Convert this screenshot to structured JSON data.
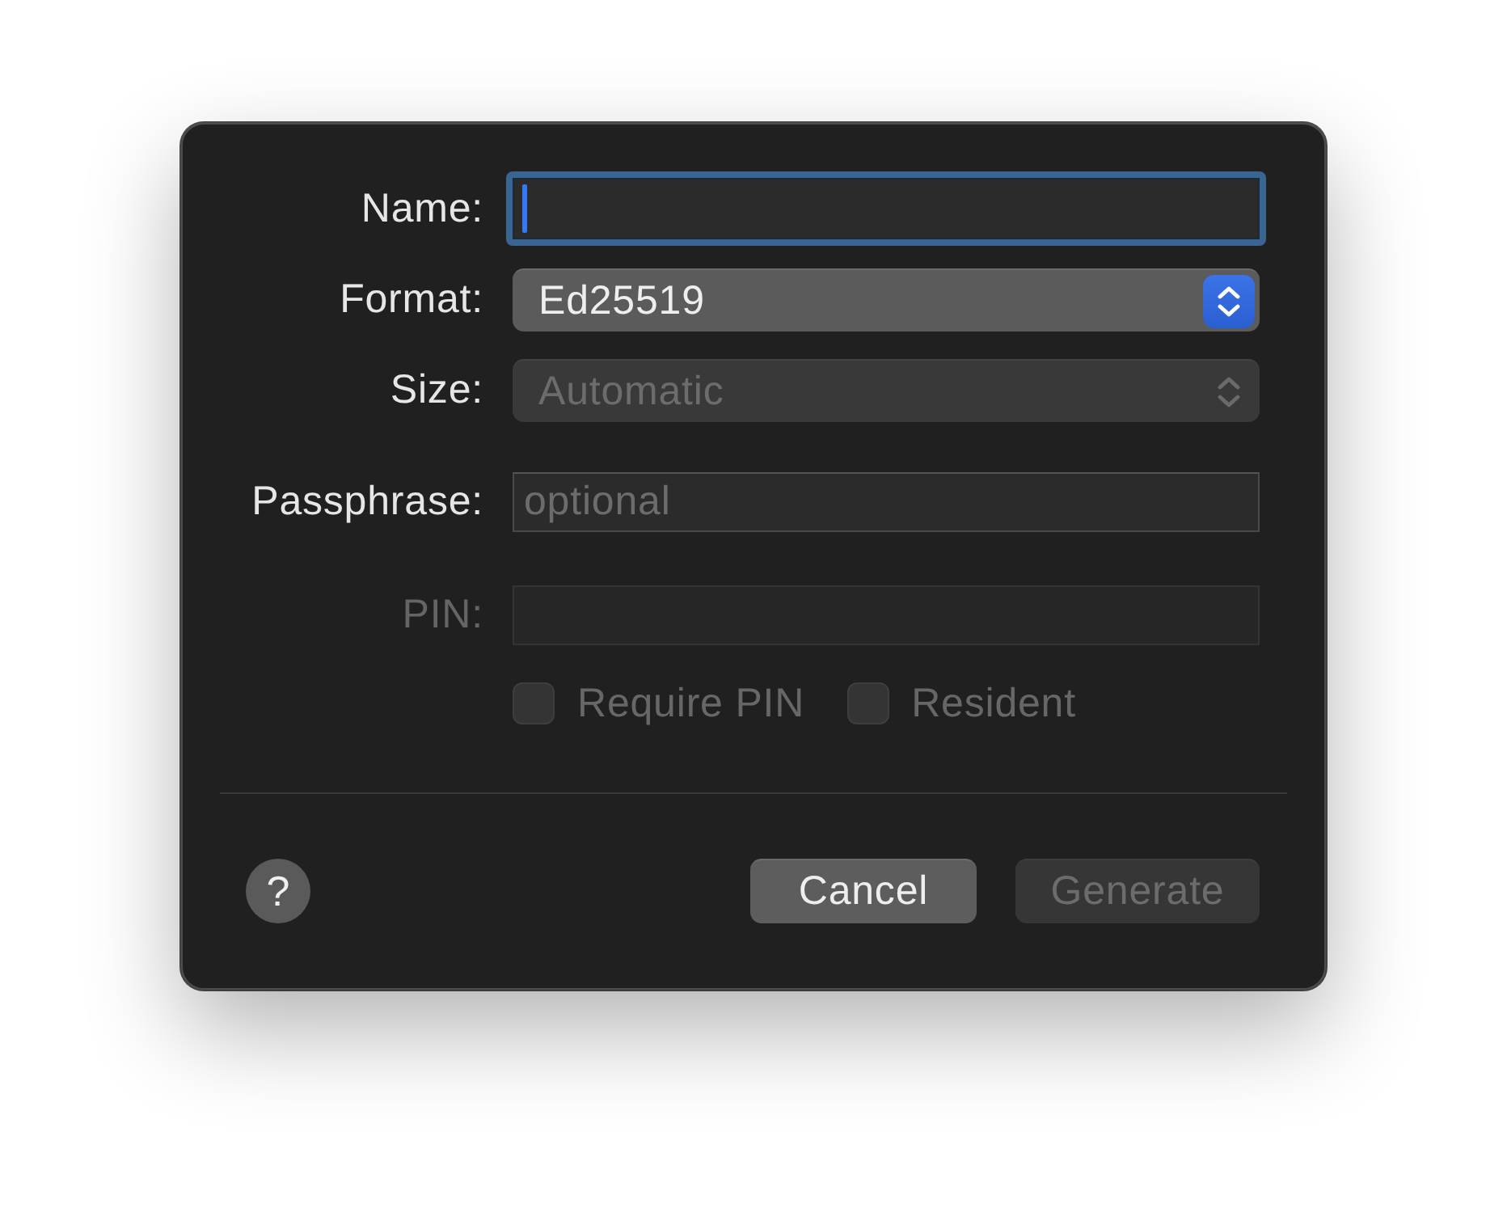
{
  "dialog": {
    "fields": [
      {
        "kind": "text",
        "label": {
          "text": "Name:",
          "disabled": false
        },
        "focused": true,
        "disabled": false
      },
      {
        "kind": "popup",
        "label": {
          "text": "Format:",
          "disabled": false
        },
        "value": "Ed25519",
        "focused": false,
        "disabled": false
      },
      {
        "kind": "popup",
        "label": {
          "text": "Size:",
          "disabled": false
        },
        "value": "Automatic",
        "focused": false,
        "disabled": true
      },
      {
        "kind": "text",
        "label": {
          "text": "Passphrase:",
          "disabled": false
        },
        "placeholder": "optional",
        "focused": false,
        "disabled": false
      },
      {
        "kind": "text",
        "label": {
          "text": "PIN:",
          "disabled": true
        },
        "focused": false,
        "disabled": true
      }
    ],
    "checkboxes": [
      {
        "label": "Require PIN",
        "checked": false,
        "disabled": true
      },
      {
        "label": "Resident",
        "checked": false,
        "disabled": true
      }
    ],
    "help_button": {
      "label": "?"
    },
    "buttons": [
      {
        "label": "Cancel",
        "disabled": false
      },
      {
        "label": "Generate",
        "disabled": true
      }
    ]
  }
}
